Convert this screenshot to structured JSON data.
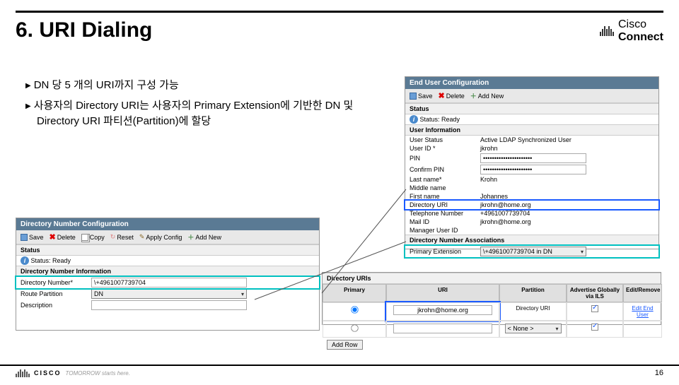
{
  "title": "6. URI Dialing",
  "logo_brand": "Cisco",
  "logo_sub": "Connect",
  "bullets": [
    "DN 당 5 개의 URI까지 구성 가능",
    "사용자의 Directory URI는 사용자의 Primary Extension에 기반한 DN 및 Directory URI 파티션(Partition)에 할당"
  ],
  "enduser": {
    "header": "End User Configuration",
    "toolbar": {
      "save": "Save",
      "delete": "Delete",
      "addnew": "Add New"
    },
    "status_section": "Status",
    "status_text": "Status: Ready",
    "info_section": "User Information",
    "fields": {
      "user_status": {
        "label": "User Status",
        "value": "Active LDAP Synchronized User"
      },
      "user_id": {
        "label": "User ID *",
        "value": "jkrohn"
      },
      "pin": {
        "label": "PIN",
        "value": "••••••••••••••••••••••"
      },
      "confirm_pin": {
        "label": "Confirm PIN",
        "value": "••••••••••••••••••••••"
      },
      "last_name": {
        "label": "Last name*",
        "value": "Krohn"
      },
      "middle_name": {
        "label": "Middle name",
        "value": ""
      },
      "first_name": {
        "label": "First name",
        "value": "Johannes"
      },
      "directory_uri": {
        "label": "Directory URI",
        "value": "jkrohn@home.org"
      },
      "telephone": {
        "label": "Telephone Number",
        "value": "+4961007739704"
      },
      "mail_id": {
        "label": "Mail ID",
        "value": "jkrohn@home.org"
      },
      "manager": {
        "label": "Manager User ID",
        "value": ""
      }
    },
    "assoc_section": "Directory Number Associations",
    "primary_ext": {
      "label": "Primary Extension",
      "value": "\\+4961007739704 in DN"
    }
  },
  "dnconfig": {
    "header": "Directory Number Configuration",
    "toolbar": {
      "save": "Save",
      "delete": "Delete",
      "copy": "Copy",
      "reset": "Reset",
      "apply": "Apply Config",
      "addnew": "Add New"
    },
    "status_section": "Status",
    "status_text": "Status: Ready",
    "info_section": "Directory Number Information",
    "fields": {
      "dn": {
        "label": "Directory Number*",
        "value": "\\+4961007739704"
      },
      "route_partition": {
        "label": "Route Partition",
        "value": "DN"
      },
      "description": {
        "label": "Description",
        "value": ""
      }
    }
  },
  "diruris": {
    "section": "Directory URIs",
    "columns": {
      "primary": "Primary",
      "uri": "URI",
      "partition": "Partition",
      "advertise": "Advertise Globally via ILS",
      "edit": "Edit/Remove"
    },
    "row": {
      "uri": "jkrohn@home.org",
      "partition": "Directory URI",
      "partition_none": "< None >",
      "edit": "Edit End User"
    },
    "addrow": "Add Row"
  },
  "footer": {
    "brand": "CISCO",
    "tagline": "TOMORROW starts here.",
    "page": "16"
  }
}
